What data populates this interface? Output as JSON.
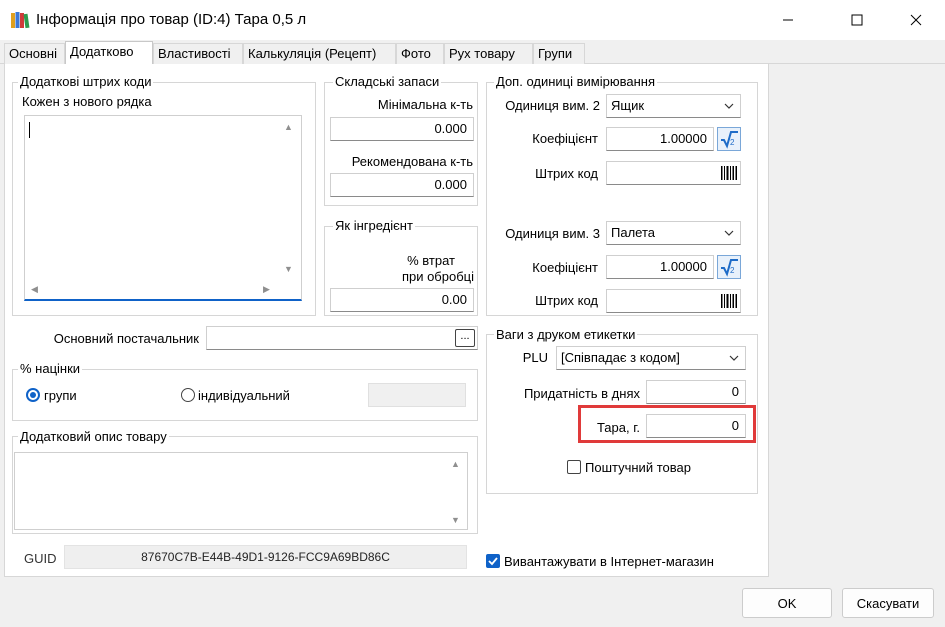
{
  "window": {
    "title": "Інформація про товар (ID:4) Тара 0,5 л",
    "minimize": "—",
    "maximize": "☐",
    "close": "✕"
  },
  "tabs": [
    {
      "label": "Основні"
    },
    {
      "label": "Додатково"
    },
    {
      "label": "Властивості"
    },
    {
      "label": "Калькуляція (Рецепт)"
    },
    {
      "label": "Фото"
    },
    {
      "label": "Рух товару"
    },
    {
      "label": "Групи"
    }
  ],
  "barcodes": {
    "legend": "Додаткові штрих коди",
    "hint": "Кожен з нового рядка",
    "value": ""
  },
  "stock": {
    "legend": "Складські запаси",
    "min_label": "Мінімальна к-ть",
    "min_value": "0.000",
    "rec_label": "Рекомендована к-ть",
    "rec_value": "0.000"
  },
  "ingredient": {
    "legend": "Як інгредієнт",
    "loss_label_1": "% втрат",
    "loss_label_2": "при обробці",
    "loss_value": "0.00"
  },
  "units": {
    "legend": "Доп. одиниці вимірювання",
    "unit2_label": "Одиниця вим. 2",
    "unit2_value": "Ящик",
    "coef2_label": "Коефіцієнт",
    "coef2_value": "1.00000",
    "barcode2_label": "Штрих код",
    "barcode2_value": "",
    "unit3_label": "Одиниця вим. 3",
    "unit3_value": "Палета",
    "coef3_label": "Коефіцієнт",
    "coef3_value": "1.00000",
    "barcode3_label": "Штрих код",
    "barcode3_value": ""
  },
  "supplier": {
    "label": "Основний постачальник",
    "value": "",
    "browse": "..."
  },
  "markup": {
    "legend": "% націнки",
    "option_group": "групи",
    "option_individual": "індивідуальний",
    "value": ""
  },
  "description": {
    "legend": "Додатковий опис товару",
    "value": ""
  },
  "guid": {
    "label": "GUID",
    "value": "87670C7B-E44B-49D1-9126-FCC9A69BD86C"
  },
  "scales": {
    "legend": "Ваги з друком етикетки",
    "plu_label": "PLU",
    "plu_value": "[Співпадає з кодом]",
    "shelf_label": "Придатність в днях",
    "shelf_value": "0",
    "tare_label": "Тара, г.",
    "tare_value": "0",
    "piece_label": "Поштучний товар"
  },
  "export": {
    "label": "Вивантажувати в Інтернет-магазин"
  },
  "buttons": {
    "ok": "OK",
    "cancel": "Скасувати"
  },
  "colors": {
    "accent": "#0f62c8",
    "highlight": "#e03a3a"
  }
}
